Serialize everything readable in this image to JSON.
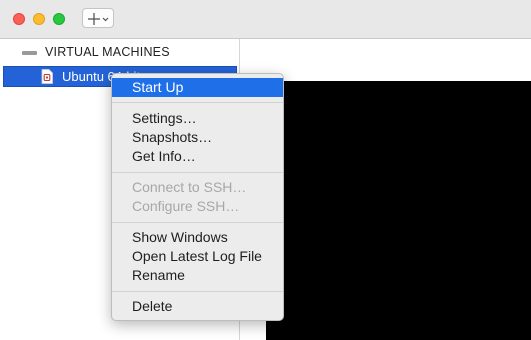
{
  "sidebar": {
    "section_header": "VIRTUAL MACHINES",
    "vm_item": {
      "label": "Ubuntu 64-bit",
      "icon": "vm-document-icon"
    }
  },
  "toolbar": {
    "add_icon": "plus-icon",
    "dropdown_icon": "chevron-down-icon"
  },
  "context_menu": {
    "start_up": "Start Up",
    "settings": "Settings…",
    "snapshots": "Snapshots…",
    "get_info": "Get Info…",
    "connect_ssh": "Connect to SSH…",
    "configure_ssh": "Configure SSH…",
    "show_windows": "Show Windows",
    "open_log": "Open Latest Log File",
    "rename": "Rename",
    "delete": "Delete"
  },
  "colors": {
    "selection": "#2463d7",
    "menu_highlight": "#1f6fe8",
    "close": "#fc5f57",
    "minimize": "#fdbc2e",
    "maximize": "#28c840"
  }
}
